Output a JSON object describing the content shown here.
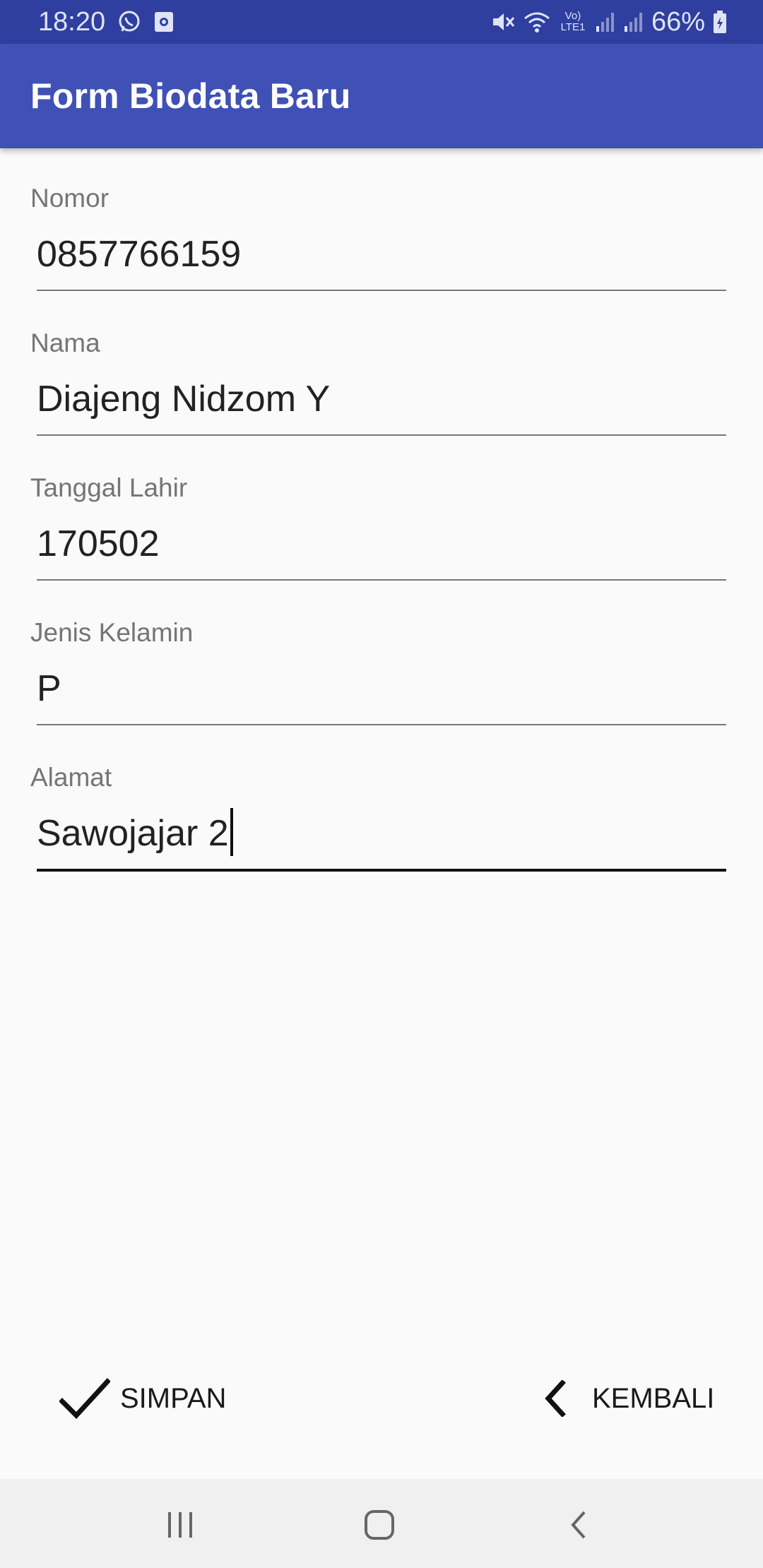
{
  "status_bar": {
    "time": "18:20",
    "battery": "66%",
    "network_label": "Vo) LTE1",
    "icons": [
      "whatsapp-icon",
      "screen-record-icon",
      "mute-icon",
      "wifi-icon",
      "signal-icon",
      "signal-icon",
      "battery-charging-icon"
    ]
  },
  "app_bar": {
    "title": "Form Biodata Baru",
    "color": "#3f51b5",
    "status_color": "#2f3f9f"
  },
  "form": {
    "nomor": {
      "label": "Nomor",
      "value": "0857766159"
    },
    "nama": {
      "label": "Nama",
      "value": "Diajeng Nidzom Y"
    },
    "tanggal_lahir": {
      "label": "Tanggal Lahir",
      "value": "170502"
    },
    "jenis_kelamin": {
      "label": "Jenis Kelamin",
      "value": "P"
    },
    "alamat": {
      "label": "Alamat",
      "value": "Sawojajar 2"
    }
  },
  "actions": {
    "save_label": "SIMPAN",
    "save_icon": "check-icon",
    "back_label": "KEMBALI",
    "back_icon": "chevron-left-icon"
  },
  "nav_bar": {
    "icons": [
      "recent-apps-icon",
      "home-icon",
      "back-icon"
    ]
  }
}
